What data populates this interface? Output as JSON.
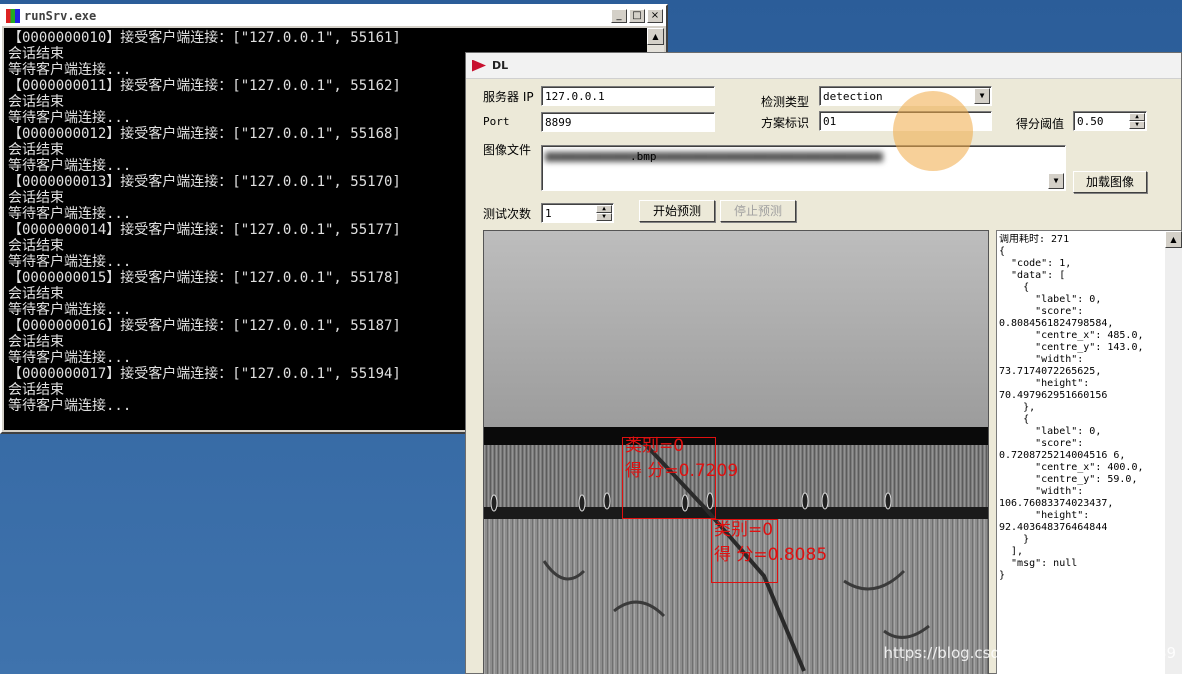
{
  "console": {
    "title": "runSrv.exe",
    "controls": [
      "_",
      "□",
      "×"
    ],
    "lines": [
      "【0000000010】接受客户端连接：[\"127.0.0.1\", 55161]",
      "会话结束",
      "等待客户端连接...",
      "【0000000011】接受客户端连接：[\"127.0.0.1\", 55162]",
      "会话结束",
      "等待客户端连接...",
      "【0000000012】接受客户端连接：[\"127.0.0.1\", 55168]",
      "会话结束",
      "等待客户端连接...",
      "【0000000013】接受客户端连接：[\"127.0.0.1\", 55170]",
      "会话结束",
      "等待客户端连接...",
      "【0000000014】接受客户端连接：[\"127.0.0.1\", 55177]",
      "会话结束",
      "等待客户端连接...",
      "【0000000015】接受客户端连接：[\"127.0.0.1\", 55178]",
      "会话结束",
      "等待客户端连接...",
      "【0000000016】接受客户端连接：[\"127.0.0.1\", 55187]",
      "会话结束",
      "等待客户端连接...",
      "【0000000017】接受客户端连接：[\"127.0.0.1\", 55194]",
      "会话结束",
      "等待客户端连接..."
    ]
  },
  "dialog": {
    "title": "DL",
    "server_ip_label": "服务器 IP",
    "server_ip_value": "127.0.0.1",
    "port_label": "Port",
    "port_value": "8899",
    "detect_type_label": "检测类型",
    "detect_type_value": "detection",
    "scheme_label": "方案标识",
    "scheme_value": "01",
    "threshold_label": "得分阈值",
    "threshold_value": "0.50",
    "image_file_label": "图像文件",
    "image_file_value": ".bmp",
    "load_button": "加载图像",
    "test_count_label": "测试次数",
    "test_count_value": "1",
    "start_button": "开始预测",
    "stop_button": "停止预测"
  },
  "detections": [
    {
      "label_text": "类别=0",
      "score_text": "得 分=0.7209"
    },
    {
      "label_text": "类别=0",
      "score_text": "得 分=0.8085"
    }
  ],
  "result_text": "调用耗时: 271\n{\n  \"code\": 1,\n  \"data\": [\n    {\n      \"label\": 0,\n      \"score\":\n0.8084561824798584,\n      \"centre_x\": 485.0,\n      \"centre_y\": 143.0,\n      \"width\":\n73.7174072265625,\n      \"height\":\n70.497962951660156\n    },\n    {\n      \"label\": 0,\n      \"score\":\n0.7208725214004516 6,\n      \"centre_x\": 400.0,\n      \"centre_y\": 59.0,\n      \"width\":\n106.76083374023437,\n      \"height\":\n92.403648376464844\n    }\n  ],\n  \"msg\": null\n}",
  "watermark": "https://blog.csdn.net/weixin_42324389"
}
